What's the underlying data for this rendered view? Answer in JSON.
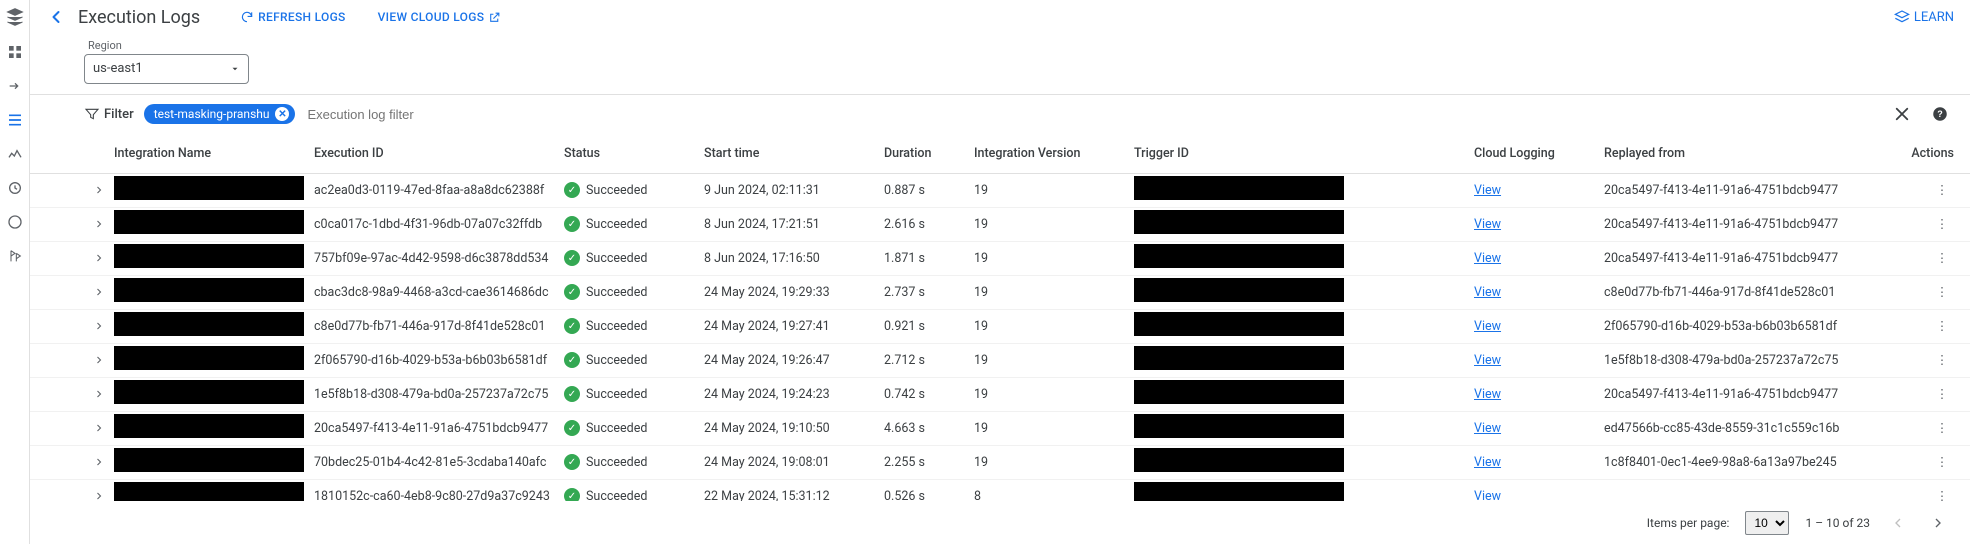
{
  "page": {
    "title": "Execution Logs"
  },
  "topbar": {
    "refresh_label": "REFRESH LOGS",
    "view_cloud_label": "VIEW CLOUD LOGS",
    "learn_label": "LEARN"
  },
  "region": {
    "label": "Region",
    "value": "us-east1"
  },
  "filter": {
    "label": "Filter",
    "chip_text": "test-masking-pranshu",
    "placeholder": "Execution log filter"
  },
  "columns": {
    "expand": "",
    "integration_name": "Integration Name",
    "execution_id": "Execution ID",
    "status": "Status",
    "start_time": "Start time",
    "duration": "Duration",
    "integration_version": "Integration Version",
    "trigger_id": "Trigger ID",
    "cloud_logging": "Cloud Logging",
    "replayed_from": "Replayed from",
    "actions": "Actions"
  },
  "status_label": "Succeeded",
  "view_label": "View",
  "rows": [
    {
      "exec_id": "ac2ea0d3-0119-47ed-8faa-a8a8dc62388f",
      "start": "9 Jun 2024, 02:11:31",
      "dur": "0.887 s",
      "iv": "19",
      "repl": "20ca5497-f413-4e11-91a6-4751bdcb9477"
    },
    {
      "exec_id": "c0ca017c-1dbd-4f31-96db-07a07c32ffdb",
      "start": "8 Jun 2024, 17:21:51",
      "dur": "2.616 s",
      "iv": "19",
      "repl": "20ca5497-f413-4e11-91a6-4751bdcb9477"
    },
    {
      "exec_id": "757bf09e-97ac-4d42-9598-d6c3878dd534",
      "start": "8 Jun 2024, 17:16:50",
      "dur": "1.871 s",
      "iv": "19",
      "repl": "20ca5497-f413-4e11-91a6-4751bdcb9477"
    },
    {
      "exec_id": "cbac3dc8-98a9-4468-a3cd-cae3614686dc",
      "start": "24 May 2024, 19:29:33",
      "dur": "2.737 s",
      "iv": "19",
      "repl": "c8e0d77b-fb71-446a-917d-8f41de528c01"
    },
    {
      "exec_id": "c8e0d77b-fb71-446a-917d-8f41de528c01",
      "start": "24 May 2024, 19:27:41",
      "dur": "0.921 s",
      "iv": "19",
      "repl": "2f065790-d16b-4029-b53a-b6b03b6581df"
    },
    {
      "exec_id": "2f065790-d16b-4029-b53a-b6b03b6581df",
      "start": "24 May 2024, 19:26:47",
      "dur": "2.712 s",
      "iv": "19",
      "repl": "1e5f8b18-d308-479a-bd0a-257237a72c75"
    },
    {
      "exec_id": "1e5f8b18-d308-479a-bd0a-257237a72c75",
      "start": "24 May 2024, 19:24:23",
      "dur": "0.742 s",
      "iv": "19",
      "repl": "20ca5497-f413-4e11-91a6-4751bdcb9477"
    },
    {
      "exec_id": "20ca5497-f413-4e11-91a6-4751bdcb9477",
      "start": "24 May 2024, 19:10:50",
      "dur": "4.663 s",
      "iv": "19",
      "repl": "ed47566b-cc85-43de-8559-31c1c559c16b"
    },
    {
      "exec_id": "70bdec25-01b4-4c42-81e5-3cdaba140afc",
      "start": "24 May 2024, 19:08:01",
      "dur": "2.255 s",
      "iv": "19",
      "repl": "1c8f8401-0ec1-4ee9-98a8-6a13a97be245"
    },
    {
      "exec_id": "1810152c-ca60-4eb8-9c80-27d9a37c9243",
      "start": "22 May 2024, 15:31:12",
      "dur": "0.526 s",
      "iv": "8",
      "repl": ""
    }
  ],
  "pager": {
    "items_per_page_label": "Items per page:",
    "items_per_page_value": "10",
    "range": "1 – 10 of 23"
  }
}
